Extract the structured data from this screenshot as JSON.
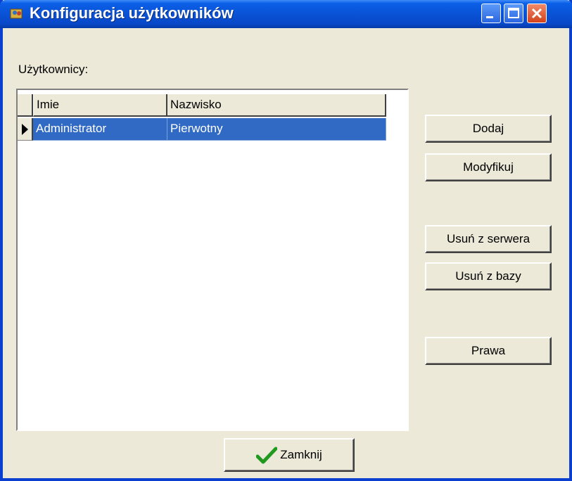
{
  "window": {
    "title": "Konfiguracja użytkowników"
  },
  "users_label": "Użytkownicy:",
  "grid": {
    "columns": [
      "Imie",
      "Nazwisko"
    ],
    "rows": [
      {
        "imie": "Administrator",
        "nazwisko": "Pierwotny",
        "selected": true
      }
    ]
  },
  "buttons": {
    "add": "Dodaj",
    "modify": "Modyfikuj",
    "remove_server": "Usuń z serwera",
    "remove_db": "Usuń z bazy",
    "rights": "Prawa",
    "close": "Zamknij"
  },
  "colors": {
    "selection": "#316ac5",
    "titlebar": "#0a54d8",
    "face": "#ece9d8"
  }
}
